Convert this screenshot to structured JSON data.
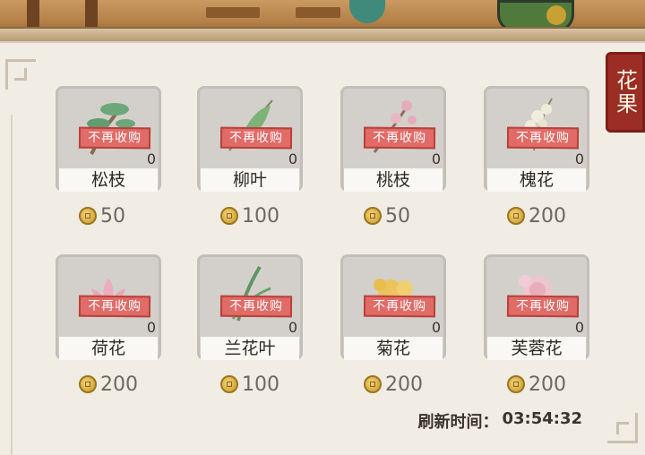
{
  "side_tab": {
    "label": "花果"
  },
  "stamp_text": "不再收购",
  "items": [
    {
      "name": "松枝",
      "count": "0",
      "price": "50",
      "icon": "pine-branch-icon"
    },
    {
      "name": "柳叶",
      "count": "0",
      "price": "100",
      "icon": "willow-leaf-icon"
    },
    {
      "name": "桃枝",
      "count": "0",
      "price": "50",
      "icon": "peach-branch-icon"
    },
    {
      "name": "槐花",
      "count": "0",
      "price": "200",
      "icon": "locust-flower-icon"
    },
    {
      "name": "荷花",
      "count": "0",
      "price": "200",
      "icon": "lotus-icon"
    },
    {
      "name": "兰花叶",
      "count": "0",
      "price": "100",
      "icon": "orchid-leaf-icon"
    },
    {
      "name": "菊花",
      "count": "0",
      "price": "200",
      "icon": "chrysanthemum-icon"
    },
    {
      "name": "芙蓉花",
      "count": "0",
      "price": "200",
      "icon": "hibiscus-icon"
    }
  ],
  "refresh": {
    "label": "刷新时间：",
    "time": "03:54:32"
  },
  "colors": {
    "stamp": "#e06b67",
    "tab": "#9b2d24",
    "coin": "#d8b04a"
  }
}
